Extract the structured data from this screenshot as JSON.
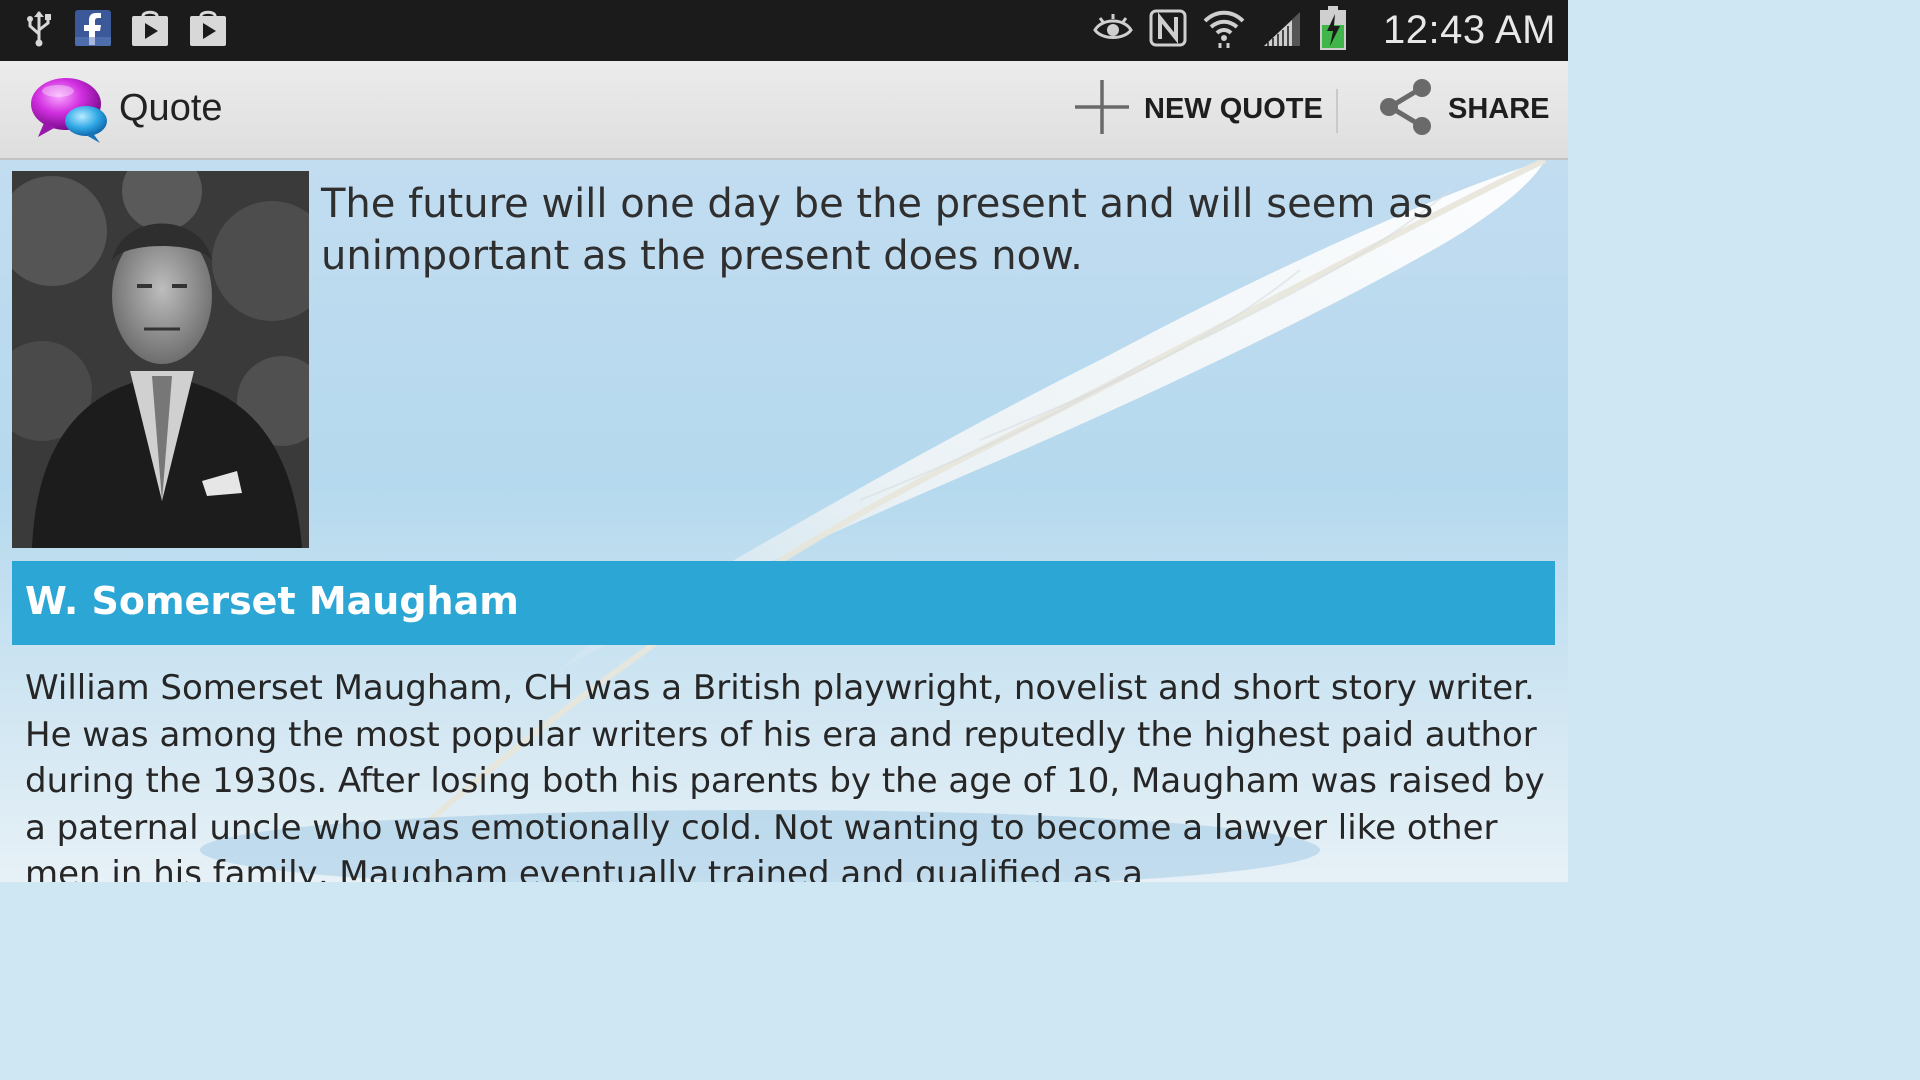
{
  "status_bar": {
    "time": "12:43 AM",
    "left_icons": [
      "usb-icon",
      "facebook-icon",
      "play-store-icon",
      "play-store-icon"
    ],
    "right_icons": [
      "eye-icon",
      "nfc-icon",
      "wifi-icon",
      "signal-icon",
      "battery-charging-icon"
    ]
  },
  "action_bar": {
    "title": "Quote",
    "new_quote_label": "NEW QUOTE",
    "share_label": "SHARE"
  },
  "quote": {
    "text": "The future will one day be the present and will seem as unimportant as the present does now.",
    "author": "W. Somerset Maugham",
    "bio": "William Somerset Maugham, CH was a British playwright, novelist and short story writer. He was among the most popular writers of his era and reputedly the highest paid author during the 1930s. After losing both his parents by the age of 10, Maugham was raised by a paternal uncle who was emotionally cold. Not wanting to become a lawyer like other men in his family, Maugham eventually trained and qualified as a"
  },
  "colors": {
    "author_bar": "#2ba6d5",
    "status_bar": "#1b1b1b",
    "action_bar": "#e6e6e6"
  }
}
